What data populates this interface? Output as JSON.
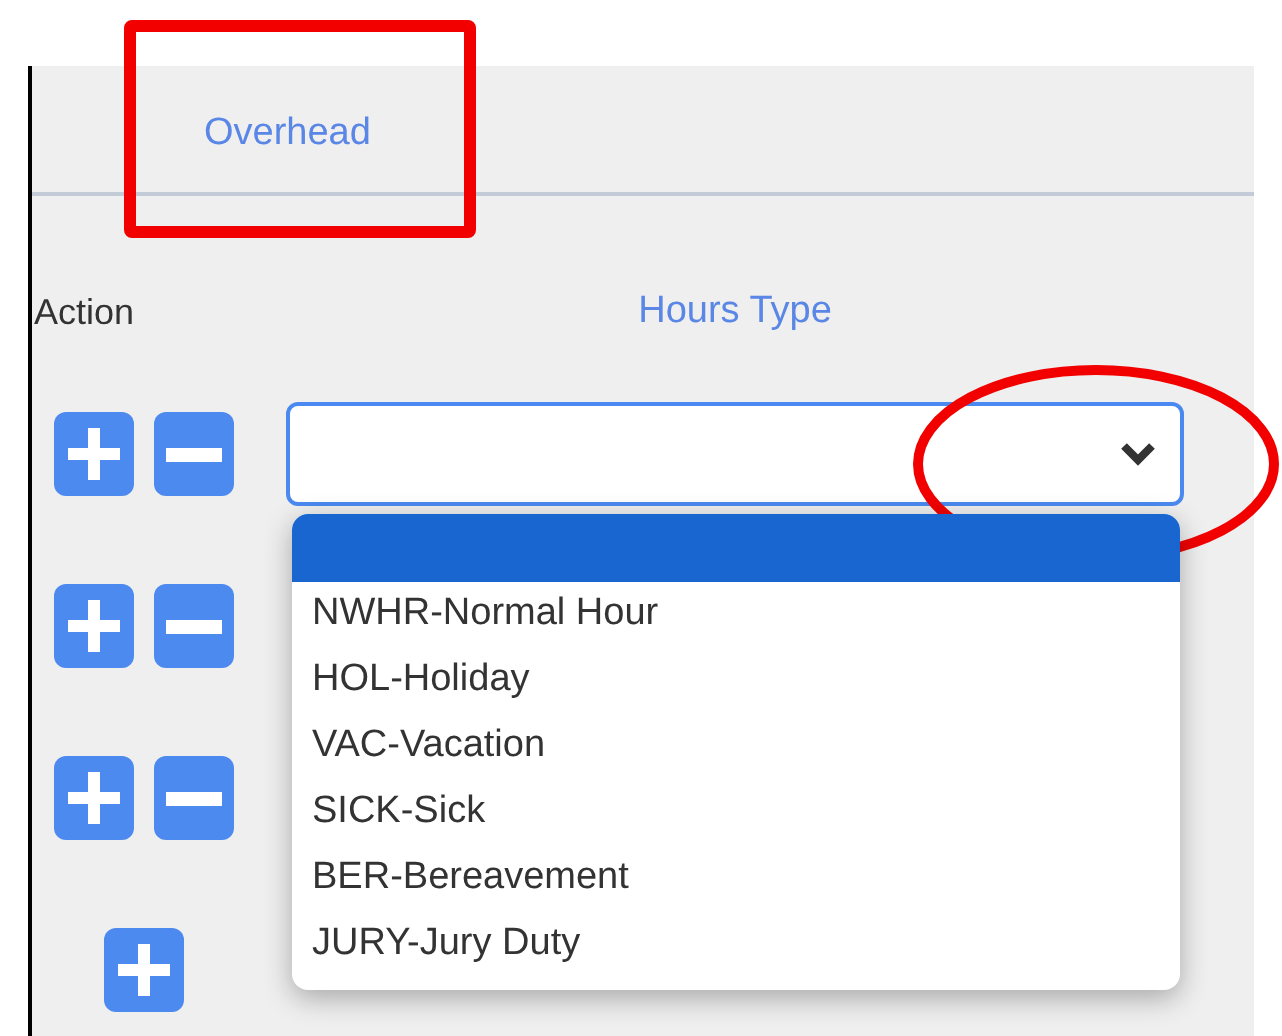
{
  "tab": {
    "label": "Overhead"
  },
  "columns": [
    "Action",
    "Hours Type"
  ],
  "rows": [
    {
      "add": true,
      "remove": true
    },
    {
      "add": true,
      "remove": true
    },
    {
      "add": true,
      "remove": true
    },
    {
      "add": true,
      "remove": false
    }
  ],
  "hours_select": {
    "open": true,
    "blank_option": {
      "selected": true
    },
    "options": [
      {
        "label": "NWHR-Normal Hour",
        "selected": false
      },
      {
        "label": "HOL-Holiday",
        "selected": false
      },
      {
        "label": "VAC-Vacation",
        "selected": false
      },
      {
        "label": "SICK-Sick",
        "selected": false
      },
      {
        "label": "BER-Bereavement",
        "selected": false
      },
      {
        "label": "JURY-Jury Duty",
        "selected": false
      }
    ]
  }
}
